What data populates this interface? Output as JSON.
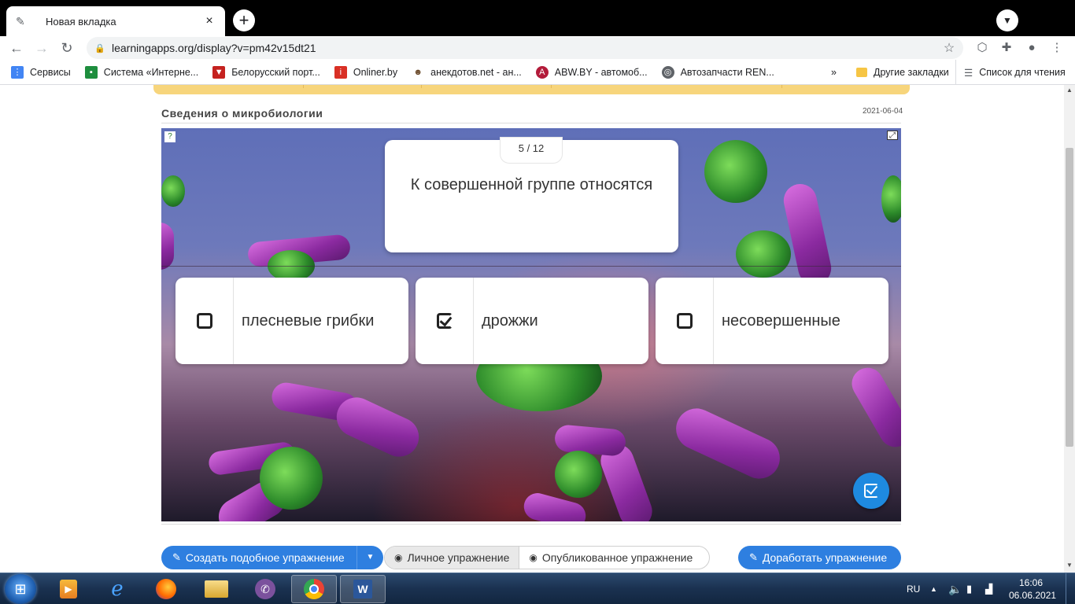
{
  "browser": {
    "tab_title": "Новая вкладка",
    "url": "learningapps.org/display?v=pm42v15dt21"
  },
  "bookmarks": {
    "items": [
      {
        "label": "Сервисы",
        "color": "#ea4335"
      },
      {
        "label": "Система «Интерне...",
        "color": "#1e8e3e"
      },
      {
        "label": "Белорусский порт...",
        "color": "#c5221f"
      },
      {
        "label": "Onliner.by",
        "color": "#d93025"
      },
      {
        "label": "анекдотов.net - ан...",
        "color": "#6b4a2a"
      },
      {
        "label": "ABW.BY - автомоб...",
        "color": "#b31b3a"
      },
      {
        "label": "Автозапчасти REN...",
        "color": "#5f6368"
      }
    ],
    "overflow": "»",
    "other": "Другие закладки",
    "reading_list": "Список для чтения"
  },
  "exercise": {
    "title": "Сведения о микробиологии",
    "date": "2021-06-04",
    "counter": "5 / 12",
    "question": "К совершенной группе относятся",
    "answers": [
      {
        "label": "плесневые грибки",
        "checked": false
      },
      {
        "label": "дрожжи",
        "checked": true
      },
      {
        "label": "несовершенные",
        "checked": false
      }
    ]
  },
  "actions": {
    "create_similar": "Создать подобное упражнение",
    "personal": "Личное упражнение",
    "published": "Опубликованное упражнение",
    "improve": "Доработать упражнение"
  },
  "taskbar": {
    "lang": "RU",
    "time": "16:06",
    "date": "06.06.2021",
    "apps": [
      "media-player",
      "internet-explorer",
      "firefox",
      "file-explorer",
      "viber",
      "chrome",
      "word"
    ]
  },
  "colors": {
    "accent_blue": "#2e7fe0",
    "yellow_bar": "#f7d57c"
  }
}
